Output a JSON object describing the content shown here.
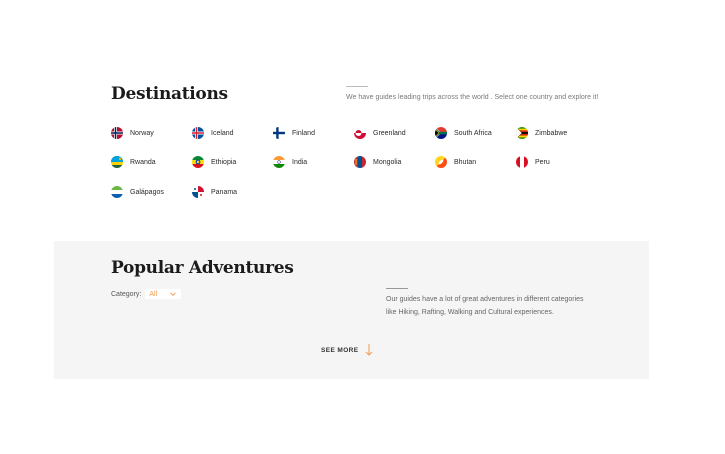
{
  "destinations": {
    "title": "Destinations",
    "description": "We have guides leading trips across the world . Select one country and explore it!",
    "countries": [
      {
        "name": "Norway",
        "flag": "norway-flag-icon"
      },
      {
        "name": "Iceland",
        "flag": "iceland-flag-icon"
      },
      {
        "name": "Finland",
        "flag": "finland-flag-icon"
      },
      {
        "name": "Greenland",
        "flag": "greenland-flag-icon"
      },
      {
        "name": "South Africa",
        "flag": "south-africa-flag-icon"
      },
      {
        "name": "Zimbabwe",
        "flag": "zimbabwe-flag-icon"
      },
      {
        "name": "Rwanda",
        "flag": "rwanda-flag-icon"
      },
      {
        "name": "Ethiopia",
        "flag": "ethiopia-flag-icon"
      },
      {
        "name": "India",
        "flag": "india-flag-icon"
      },
      {
        "name": "Mongolia",
        "flag": "mongolia-flag-icon"
      },
      {
        "name": "Bhutan",
        "flag": "bhutan-flag-icon"
      },
      {
        "name": "Peru",
        "flag": "peru-flag-icon"
      },
      {
        "name": "Galápagos",
        "flag": "galapagos-flag-icon"
      },
      {
        "name": "Panama",
        "flag": "panama-flag-icon"
      }
    ]
  },
  "adventures": {
    "title": "Popular Adventures",
    "category_label": "Category:",
    "category_value": "All",
    "description": "Our guides have a lot of great adventures in different categories like Hiking, Rafting, Walking and Cultural experiences.",
    "see_more_label": "SEE MORE"
  },
  "colors": {
    "accent": "#f29c50",
    "panel_bg": "#f5f5f6"
  }
}
